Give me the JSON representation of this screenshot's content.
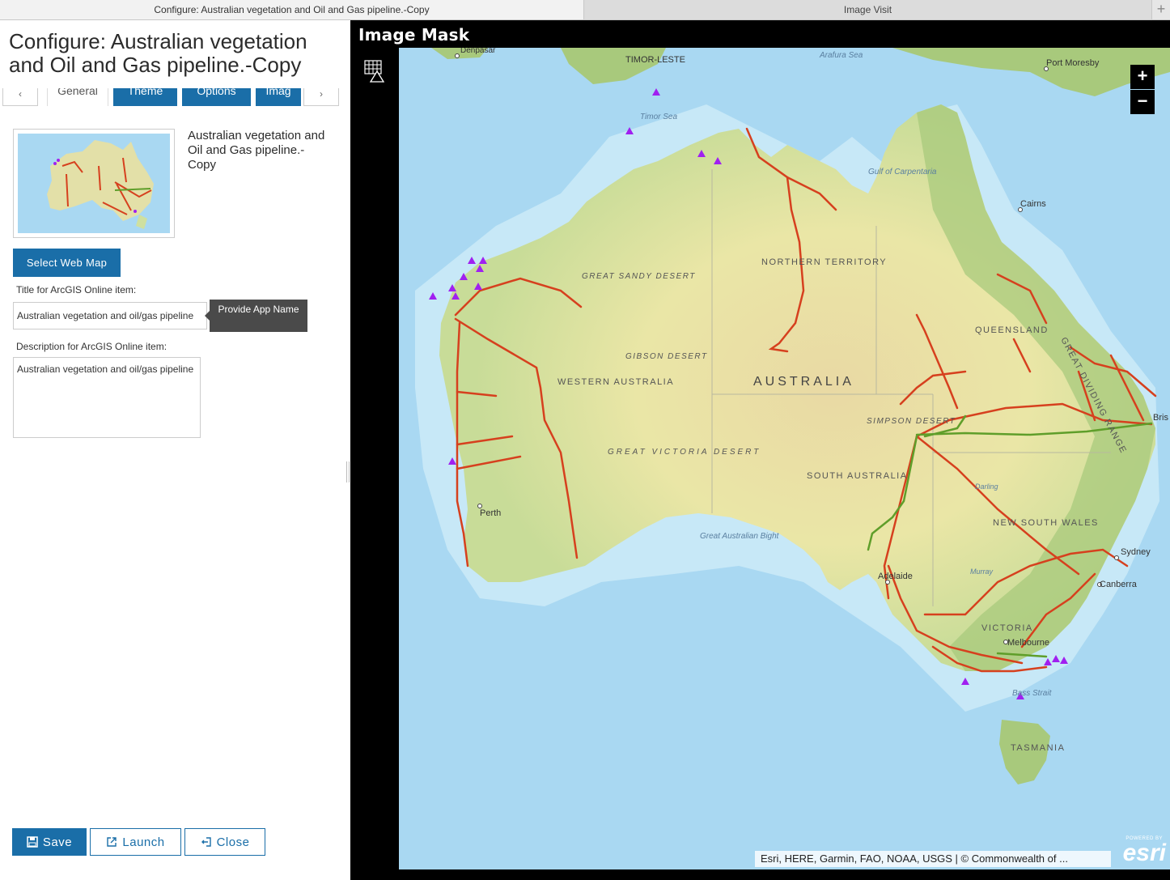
{
  "browser": {
    "tabs": [
      {
        "label": "Configure: Australian vegetation and Oil and Gas pipeline.-Copy",
        "active": true
      },
      {
        "label": "Image Visit",
        "active": false
      }
    ],
    "add_tab_glyph": "+"
  },
  "panel": {
    "title": "Configure: Australian vegetation and Oil and Gas pipeline.-Copy",
    "tabs": [
      {
        "label": "General",
        "active": true
      },
      {
        "label": "Theme",
        "active": false
      },
      {
        "label": "Options",
        "active": false
      },
      {
        "label": "Imag",
        "active": false
      }
    ],
    "prev_glyph": "‹",
    "next_glyph": "›",
    "item_title": "Australian vegetation and Oil and Gas pipeline.-Copy",
    "select_webmap_label": "Select Web Map",
    "title_field_label": "Title for ArcGIS Online item:",
    "title_field_value": "Australian vegetation and oil/gas pipeline",
    "tooltip": "Provide App Name",
    "description_label": "Description for ArcGIS Online item:",
    "description_value": "Australian vegetation and oil/gas pipeline",
    "save_label": "Save",
    "launch_label": "Launch",
    "close_label": "Close"
  },
  "app": {
    "title": "Image Mask",
    "zoom_in": "+",
    "zoom_out": "−",
    "attribution": "Esri, HERE, Garmin, FAO, NOAA, USGS | © Commonwealth of ...",
    "powered_by": "POWERED BY",
    "brand": "esri",
    "colors": {
      "ocean": "#a9d8f2",
      "land": "#e6e2a8",
      "pipeline": "#d6401e",
      "gas_line": "#5f9e2a",
      "site_marker": "#a020f0",
      "accent": "#1a6ea8"
    },
    "map_labels": {
      "country": "AUSTRALIA",
      "timor_leste": "TIMOR-LESTE",
      "arafura_sea": "Arafura Sea",
      "timor_sea": "Timor Sea",
      "port_moresby": "Port Moresby",
      "gulf": "Gulf of Carpentaria",
      "cairns": "Cairns",
      "nt": "NORTHERN TERRITORY",
      "great_sandy": "GREAT SANDY DESERT",
      "queensland": "QUEENSLAND",
      "gibson": "GIBSON DESERT",
      "wa": "WESTERN AUSTRALIA",
      "simpson": "SIMPSON DESERT",
      "great_victoria": "GREAT VICTORIA DESERT",
      "sa": "SOUTH AUSTRALIA",
      "dividing_range": "GREAT DIVIDING RANGE",
      "perth": "Perth",
      "bight": "Great Australian Bight",
      "nsw": "NEW SOUTH WALES",
      "sydney": "Sydney",
      "adelaide": "Adelaide",
      "canberra": "Canberra",
      "victoria": "VICTORIA",
      "melbourne": "Melbourne",
      "bass_strait": "Bass Strait",
      "tasmania": "TASMANIA",
      "darling": "Darling",
      "murray": "Murray",
      "denpasar": "Denpasar",
      "brisbane": "Bris"
    }
  }
}
